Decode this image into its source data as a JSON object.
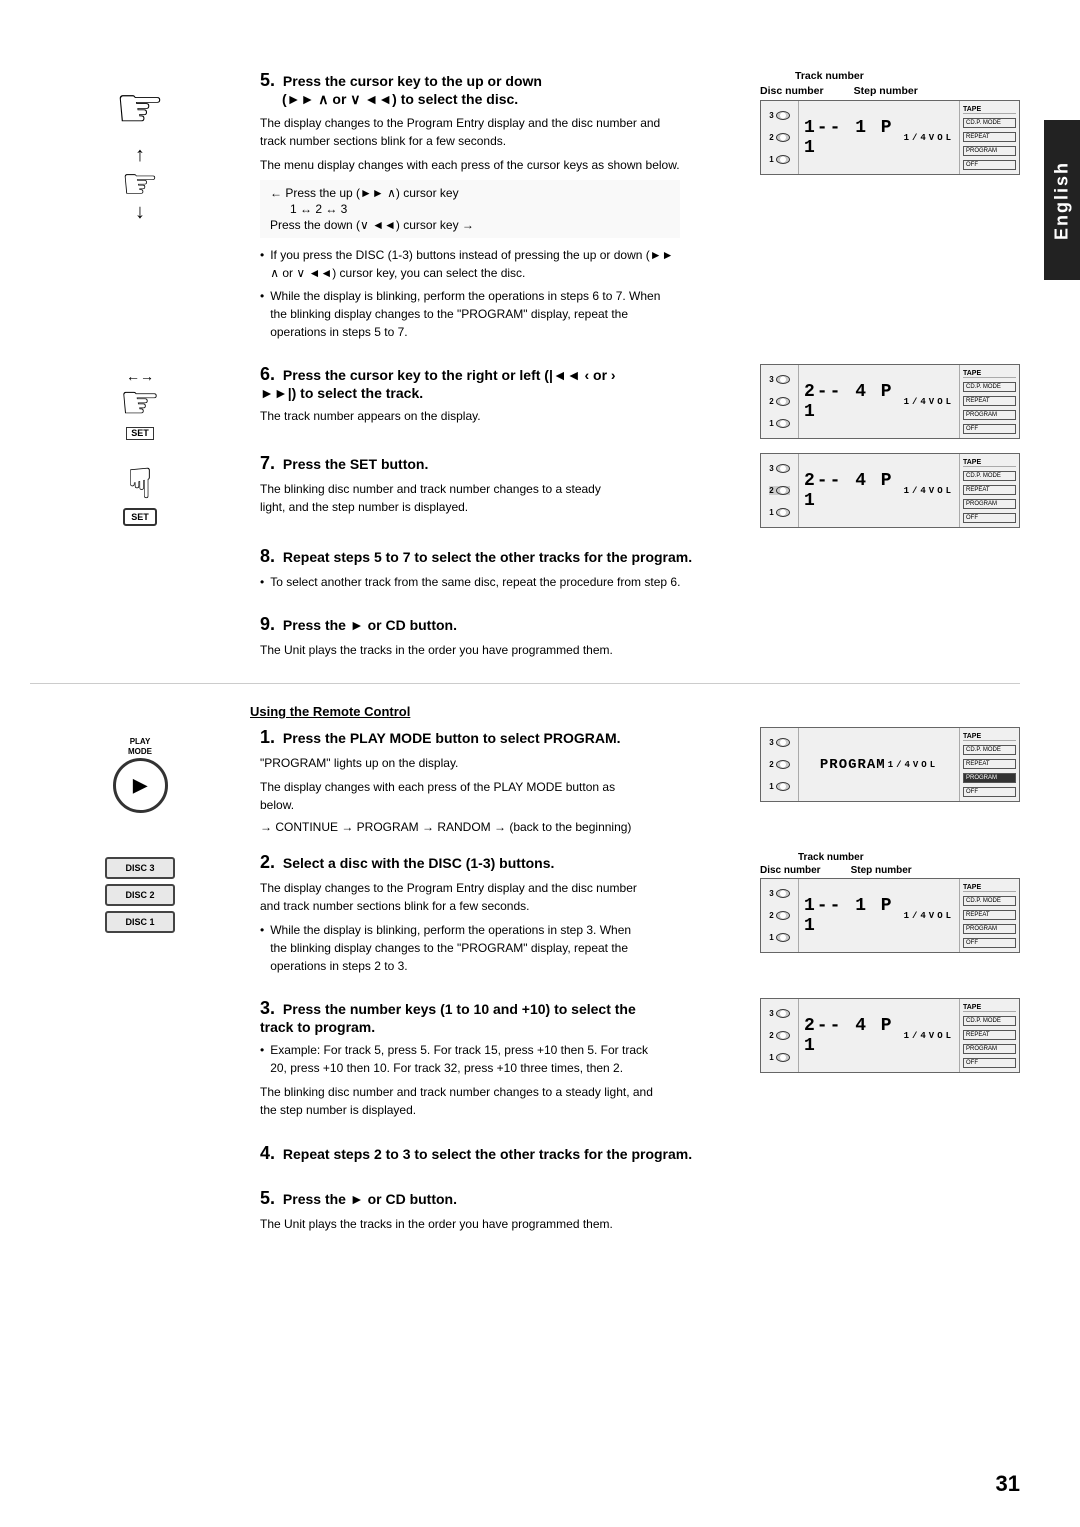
{
  "page": {
    "number": "31",
    "language_tab": "English"
  },
  "steps": [
    {
      "id": "step5",
      "number": "5",
      "header": "Press the cursor key to the up or down",
      "subheader": "(►► ∧ or ∨ ◄◄) to select the disc.",
      "body1": "The display changes to the Program Entry display and the disc number and track number sections blink for a few seconds.",
      "body2": "The menu display changes with each press of the cursor keys as shown below.",
      "cursor_note": {
        "up_label": "← Press the up (►► ∧) cursor key",
        "up_seq": "1 ↔ 2 ↔ 3",
        "down_label": "Press the down (∨ ◄◄) cursor key →"
      },
      "bullets": [
        "If you press the DISC (1-3) buttons instead of pressing the up or down (►► ∧ or ∨ ◄◄) cursor key, you can select the disc.",
        "While the display is blinking, perform the operations in steps 6 to 7. When the blinking display changes to the \"PROGRAM\" display, repeat the operations in steps 5 to 7."
      ],
      "display_labels": {
        "track_number": "Track number",
        "disc_number": "Disc number",
        "step_number": "Step number"
      }
    },
    {
      "id": "step6",
      "number": "6",
      "header": "Press the cursor key to the right or left (|◄◄ ‹ or › ►►|) to select the track.",
      "body": "The track number appears on the display."
    },
    {
      "id": "step7",
      "number": "7",
      "header": "Press the SET button.",
      "body": "The blinking disc number and track number changes to a steady light, and the step number is displayed."
    },
    {
      "id": "step8",
      "number": "8",
      "header": "Repeat steps 5 to 7 to select the other tracks for the program.",
      "bullet": "To select another track from the same disc, repeat the procedure from step 6."
    },
    {
      "id": "step9",
      "number": "9",
      "header": "Press the ► or CD button.",
      "body": "The Unit plays the tracks in the order you have programmed them."
    }
  ],
  "remote_section": {
    "heading": "Using the Remote Control",
    "steps": [
      {
        "id": "r_step1",
        "number": "1",
        "header": "Press the PLAY MODE button to select PROGRAM.",
        "body1": "\"PROGRAM\" lights up on the display.",
        "body2": "The display changes with each press of the PLAY MODE button as below.",
        "flow": "→ CONTINUE → PROGRAM → RANDOM → (back to the beginning)"
      },
      {
        "id": "r_step2",
        "number": "2",
        "header": "Select a disc with the DISC (1-3) buttons.",
        "body1": "The display changes to the Program Entry display and the disc number and track number sections blink for a few seconds.",
        "bullet": "While the display is blinking, perform the operations in step 3. When the blinking display changes to the \"PROGRAM\" display, repeat the operations in steps 2 to 3.",
        "display_labels": {
          "track_number": "Track number",
          "disc_number": "Disc number",
          "step_number": "Step number"
        }
      },
      {
        "id": "r_step3",
        "number": "3",
        "header": "Press the number keys (1 to 10 and +10) to select the track to program.",
        "bullet": "Example: For track 5, press 5. For track 15, press +10 then 5. For track 20, press +10 then 10. For track 32, press +10 three times, then 2.",
        "body2": "The blinking disc number and track number changes to a steady light, and the step number is displayed."
      },
      {
        "id": "r_step4",
        "number": "4",
        "header": "Repeat steps 2 to 3 to select the other tracks for the program."
      },
      {
        "id": "r_step5",
        "number": "5",
        "header": "Press the ► or CD button.",
        "body": "The Unit plays the tracks in the order you have programmed them."
      }
    ]
  },
  "displays": {
    "disc_numbers": [
      "3",
      "2",
      "1"
    ],
    "seg_text_1": "1 -- 1 P  1",
    "seg_text_2": "2 -- 4 P  1",
    "seg_text_3": "2 -- 4 P  1",
    "seg_program": "PROGRAM",
    "badges": {
      "cd_p_mode": "CD.P. MODE",
      "repeat": "REPEAT",
      "program": "PROGRAM",
      "off": "OFF"
    },
    "tape_label": "TAPE",
    "vol_label": "1/4 VOL"
  }
}
